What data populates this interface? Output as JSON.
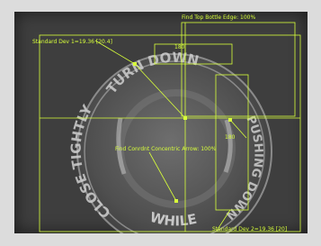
{
  "overlay": {
    "color": "#d8ff3a",
    "labels": {
      "bottle_edge": "Find Top Bottle Edge: 100%",
      "std_dev_1": "Standard Dev 1=19.36 [20.4]",
      "angle_top": "180",
      "angle_right": "180",
      "concentric": "Find Conrdnt Concentric Arrow: 100%",
      "std_dev_2": "Standard Dev 2=19.36 [20]"
    }
  },
  "cap": {
    "text_top": "TURN DOWN",
    "text_left": "CLOSE TIGHTLY",
    "text_bottom": "WHILE",
    "text_right": "PUSHING DOWN"
  }
}
